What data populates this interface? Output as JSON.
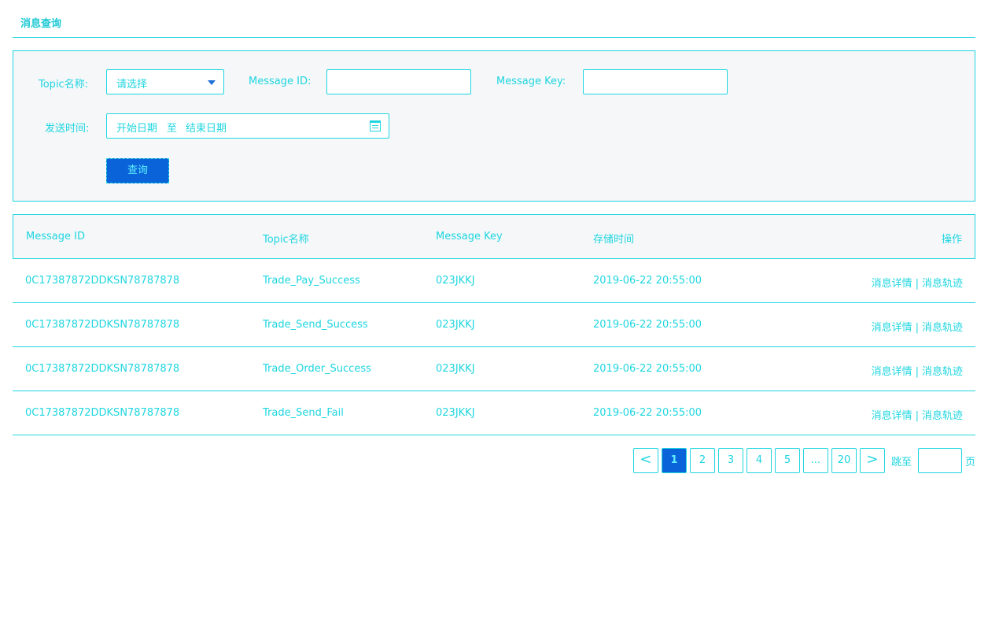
{
  "page": {
    "title": "消息查询"
  },
  "filters": {
    "topic_label": "Topic名称:",
    "topic_select_value": "请选择",
    "message_id_label": "Message ID:",
    "message_id_value": "",
    "message_key_label": "Message Key:",
    "message_key_value": "",
    "send_time_label": "发送时间:",
    "start_date_placeholder": "开始日期",
    "range_separator": "至",
    "end_date_placeholder": "结束日期",
    "query_button": "查询"
  },
  "table": {
    "columns": [
      "Message ID",
      "Topic名称",
      "Message Key",
      "存储时间",
      "操作"
    ],
    "rows": [
      {
        "message_id": "0C17387872DDKSN78787878",
        "topic": "Trade_Pay_Success",
        "key": "023JKKJ",
        "time": "2019-06-22 20:55:00",
        "op_detail": "消息详情",
        "op_sep": "|",
        "op_trace": "消息轨迹"
      },
      {
        "message_id": "0C17387872DDKSN78787878",
        "topic": "Trade_Send_Success",
        "key": "023JKKJ",
        "time": "2019-06-22 20:55:00",
        "op_detail": "消息详情",
        "op_sep": "|",
        "op_trace": "消息轨迹"
      },
      {
        "message_id": "0C17387872DDKSN78787878",
        "topic": "Trade_Order_Success",
        "key": "023JKKJ",
        "time": "2019-06-22 20:55:00",
        "op_detail": "消息详情",
        "op_sep": "|",
        "op_trace": "消息轨迹"
      },
      {
        "message_id": "0C17387872DDKSN78787878",
        "topic": "Trade_Send_Fail",
        "key": "023JKKJ",
        "time": "2019-06-22 20:55:00",
        "op_detail": "消息详情",
        "op_sep": "|",
        "op_trace": "消息轨迹"
      }
    ]
  },
  "pagination": {
    "prev": "<",
    "pages": [
      "1",
      "2",
      "3",
      "4",
      "5",
      "...",
      "20"
    ],
    "current": "1",
    "next": ">",
    "jump_label": "跳至",
    "jump_value": "",
    "page_unit": "页"
  },
  "colors": {
    "accent": "#1fd6e0",
    "primary_button": "#0a63d8",
    "panel_bg": "#f5f7f9"
  },
  "icons": {
    "select_caret": "caret-down-icon",
    "date_picker": "calendar-icon"
  }
}
